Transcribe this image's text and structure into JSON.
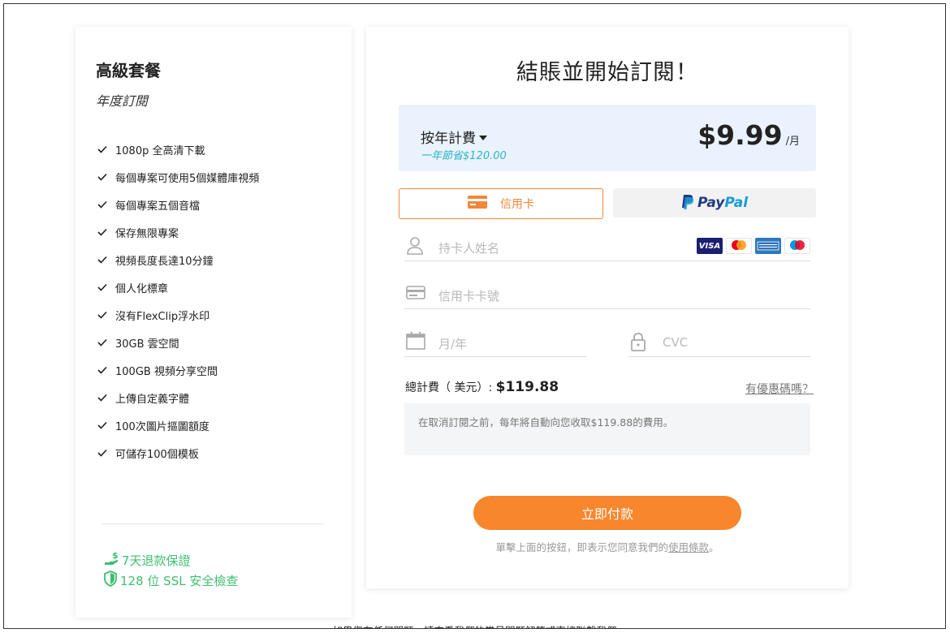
{
  "plan": {
    "title": "高級套餐",
    "subtitle": "年度訂閱",
    "features": [
      "1080p 全高清下載",
      "每個專案可使用5個媒體庫視頻",
      "每個專案五個音檔",
      "保存無限專案",
      "視頻長度長達10分鐘",
      "個人化標章",
      "沒有FlexClip浮水印",
      "30GB 雲空間",
      "100GB 視頻分享空間",
      "上傳自定義字體",
      "100次圖片摳圖額度",
      "可儲存100個模板"
    ],
    "guarantees": {
      "refund": "7天退款保證",
      "ssl": "128 位 SSL 安全檢查"
    }
  },
  "checkout": {
    "title": "結賬並開始訂閱！",
    "billing": {
      "period": "按年計費",
      "savings": "一年節省$120.00",
      "price": "$9.99",
      "unit": "/月"
    },
    "payment_methods": {
      "card": "信用卡",
      "paypal_pay": "Pay",
      "paypal_pal": "Pal"
    },
    "fields": {
      "name_placeholder": "持卡人姓名",
      "card_placeholder": "信用卡卡號",
      "expiry_placeholder": "月/年",
      "cvc_placeholder": "CVC"
    },
    "card_brands": [
      "VISA",
      "mastercard",
      "AMERICAN EXPRESS",
      "maestro"
    ],
    "total_label": "總計費（ 美元）:",
    "total_amount": "$119.88",
    "coupon_link": "有優惠碼嗎？",
    "notice": "在取消訂閱之前，每年將自動向您收取$119.88的費用。",
    "pay_button": "立即付款",
    "terms_prefix": "單擊上面的按鈕，即表示您同意我們的",
    "terms_link": "使用條款",
    "terms_suffix": "。"
  },
  "footer": {
    "help": "如果您有任何問題，請查看我們的常見問題解答或直接聯繫我們"
  },
  "colors": {
    "accent_orange": "#f7862c",
    "green": "#3fbf71",
    "teal": "#2bb4c6",
    "billing_bg": "#eaf3fd"
  }
}
